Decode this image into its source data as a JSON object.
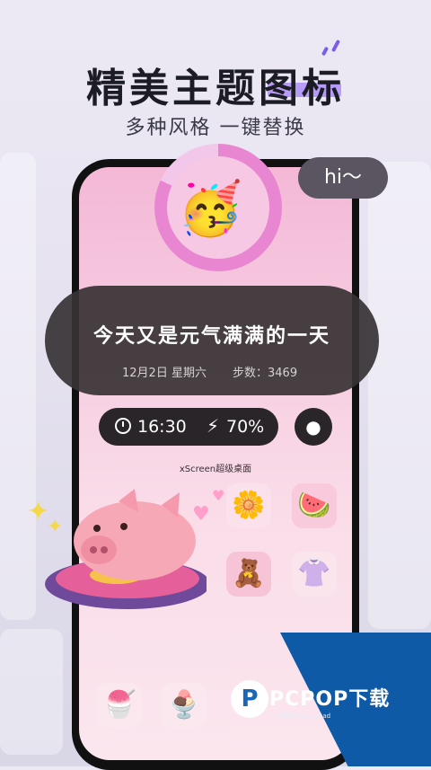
{
  "headline": {
    "title": "精美主题图标",
    "subtitle": "多种风格 一键替换"
  },
  "bubble": {
    "text": "hi～"
  },
  "avatar": {
    "emoji": "🥳"
  },
  "banner": {
    "title": "今天又是元气满满的一天",
    "date": "12月2日 星期六",
    "steps": "步数：3469"
  },
  "status": {
    "time": "16:30",
    "battery": "70%"
  },
  "caption": "xScreen超级桌面",
  "tiles": {
    "flower": "🌼",
    "watermelon": "🍉",
    "bear": "🧸",
    "shirt": "👚",
    "icecream": "🍧",
    "sundae": "🍨"
  },
  "watermark": {
    "brand": "PCPOP下载",
    "sub": "PCPOP Download"
  }
}
